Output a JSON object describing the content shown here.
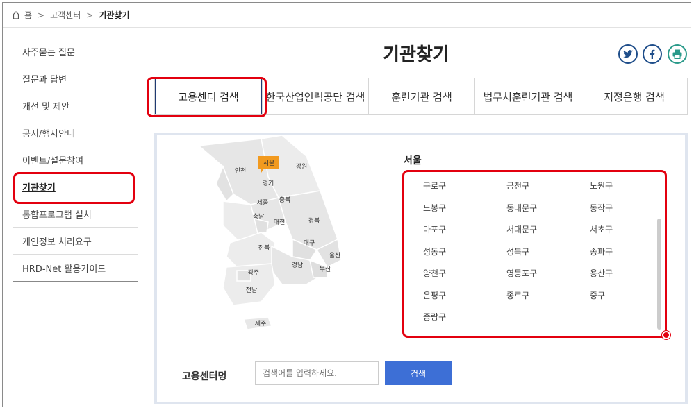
{
  "breadcrumb": {
    "home": "홈",
    "parent": "고객센터",
    "current": "기관찾기",
    "home_icon": "home-icon",
    "separator": ">"
  },
  "sidebar": {
    "items": [
      {
        "label": "자주묻는 질문"
      },
      {
        "label": "질문과 답변"
      },
      {
        "label": "개선 및 제안"
      },
      {
        "label": "공지/행사안내"
      },
      {
        "label": "이벤트/설문참여"
      },
      {
        "label": "기관찾기"
      },
      {
        "label": "통합프로그램 설치"
      },
      {
        "label": "개인정보 처리요구"
      },
      {
        "label": "HRD-Net 활용가이드"
      }
    ],
    "active_index": 5
  },
  "page": {
    "title": "기관찾기"
  },
  "share": {
    "twitter_icon": "twitter-icon",
    "facebook_icon": "facebook-icon",
    "print_icon": "print-icon"
  },
  "tabs": [
    {
      "label": "고용센터 검색",
      "active": true
    },
    {
      "label": "한국산업인력공단 검색"
    },
    {
      "label": "훈련기관 검색"
    },
    {
      "label": "법무처훈련기관 검색"
    },
    {
      "label": "지정은행 검색"
    }
  ],
  "map": {
    "selected": "서울",
    "regions": {
      "incheon": "인천",
      "seoul": "서울",
      "gangwon": "강원",
      "gyeonggi": "경기",
      "sejong": "세종",
      "chungbuk": "충북",
      "chungnam": "충남",
      "daejeon": "대전",
      "gyeongbuk": "경북",
      "daegu": "대구",
      "jeonbuk": "전북",
      "ulsan": "울산",
      "gyeongnam": "경남",
      "busan": "부산",
      "gwangju": "광주",
      "jeonnam": "전남",
      "jeju": "제주"
    }
  },
  "region": {
    "title": "서울",
    "districts": [
      "구로구",
      "금천구",
      "노원구",
      "도봉구",
      "동대문구",
      "동작구",
      "마포구",
      "서대문구",
      "서초구",
      "성동구",
      "성북구",
      "송파구",
      "양천구",
      "영등포구",
      "용산구",
      "은평구",
      "종로구",
      "중구",
      "중랑구"
    ]
  },
  "search": {
    "label": "고용센터명",
    "placeholder": "검색어를 입력하세요.",
    "button": "검색"
  },
  "colors": {
    "highlight": "#e3000f",
    "button": "#3d6fd6",
    "tab_active_border": "#1f3b73",
    "map_selected": "#f29a1f"
  }
}
